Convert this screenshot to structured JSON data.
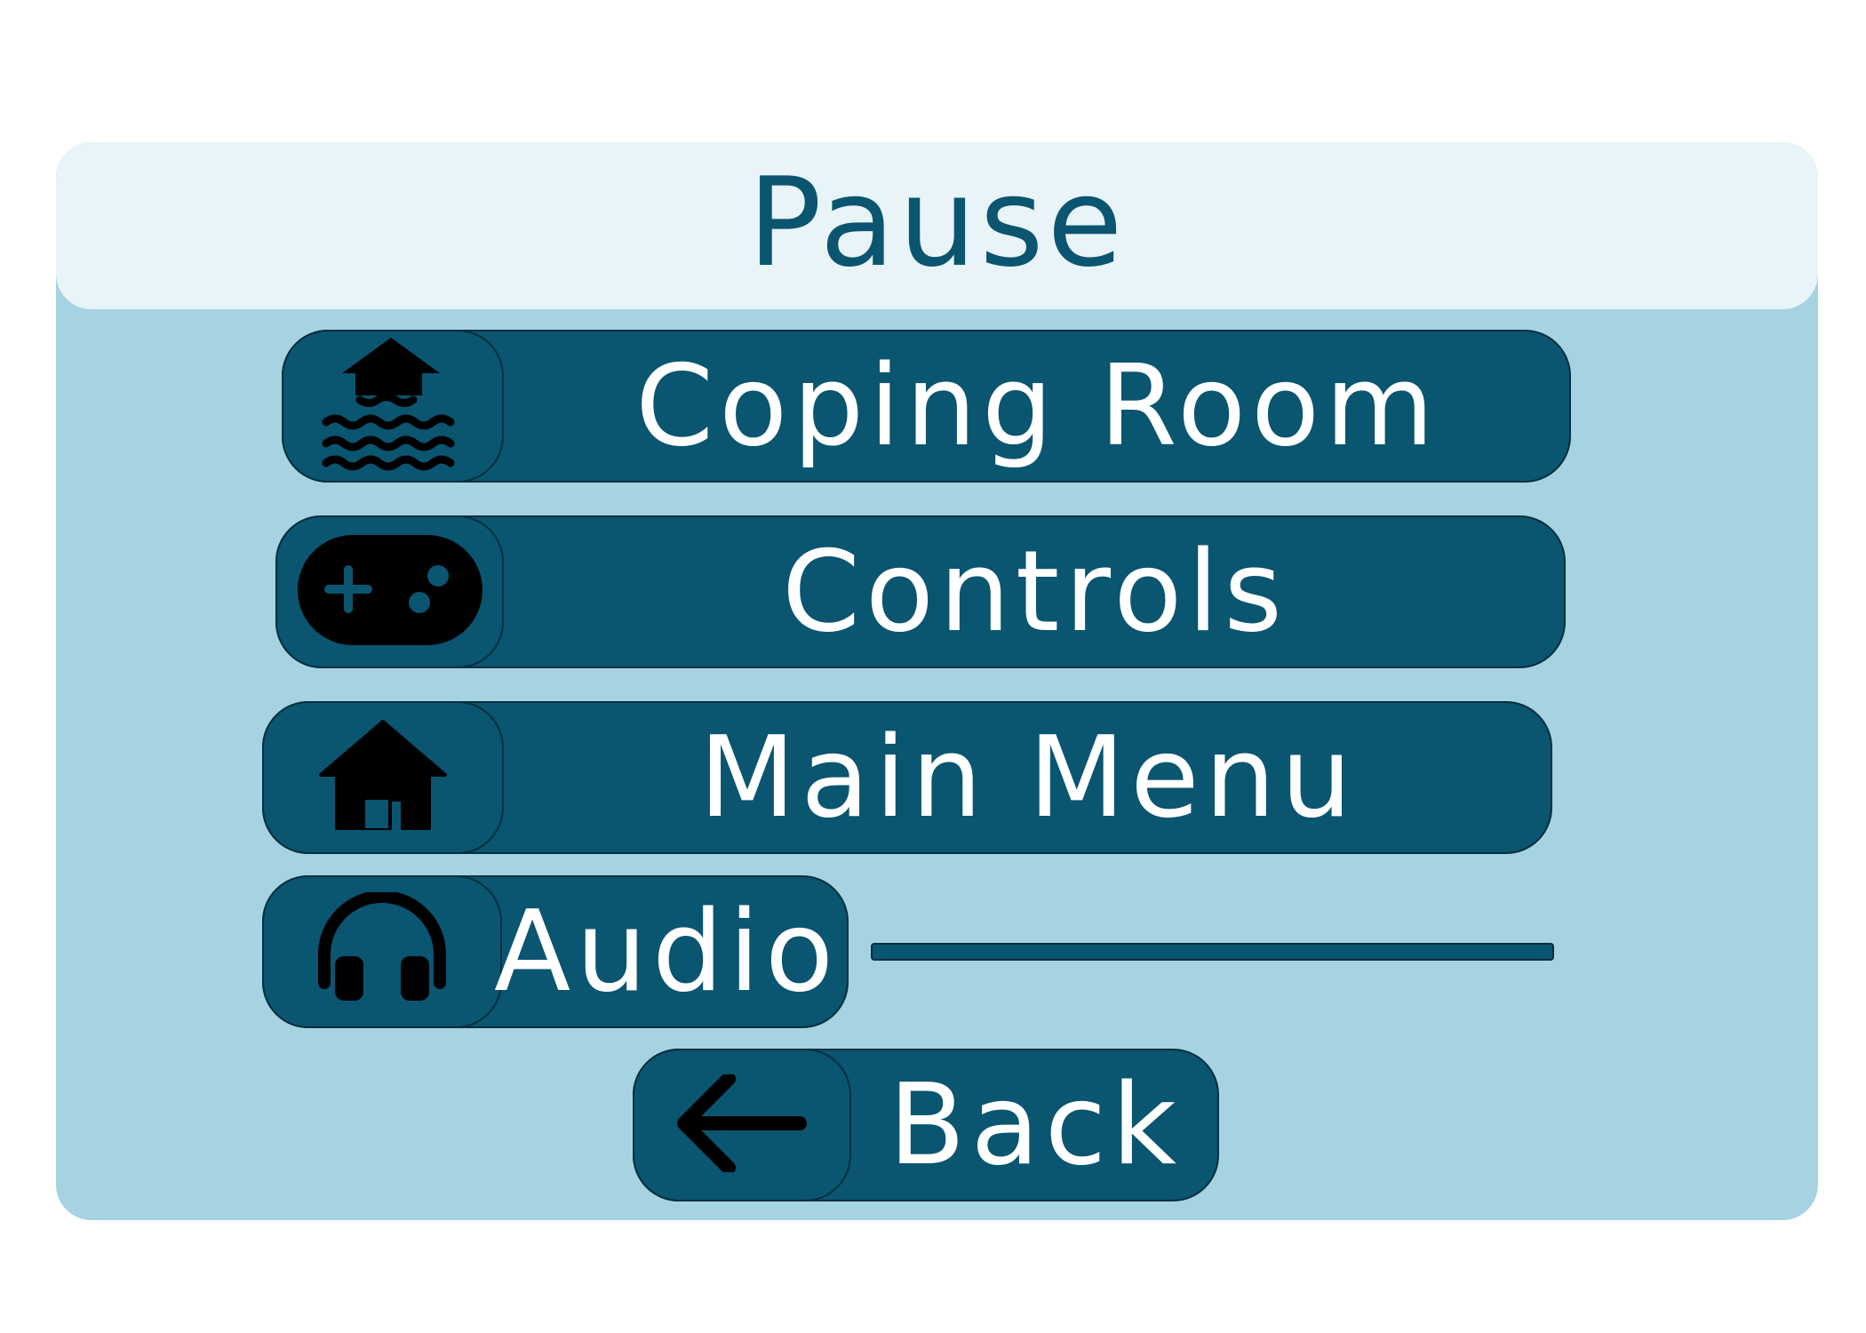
{
  "title": "Pause",
  "menu": {
    "coping_room": {
      "label": "Coping Room",
      "icon": "flooded-house-icon"
    },
    "controls": {
      "label": "Controls",
      "icon": "gamepad-icon"
    },
    "main_menu": {
      "label": "Main Menu",
      "icon": "home-icon"
    },
    "audio": {
      "label": "Audio",
      "icon": "headphones-icon"
    },
    "back": {
      "label": "Back",
      "icon": "arrow-left-icon"
    }
  },
  "colors": {
    "button": "#0a5570",
    "panel": "#a6d3e2",
    "header": "#e8f4f8",
    "title_text": "#0b5570",
    "button_text": "#ffffff"
  }
}
